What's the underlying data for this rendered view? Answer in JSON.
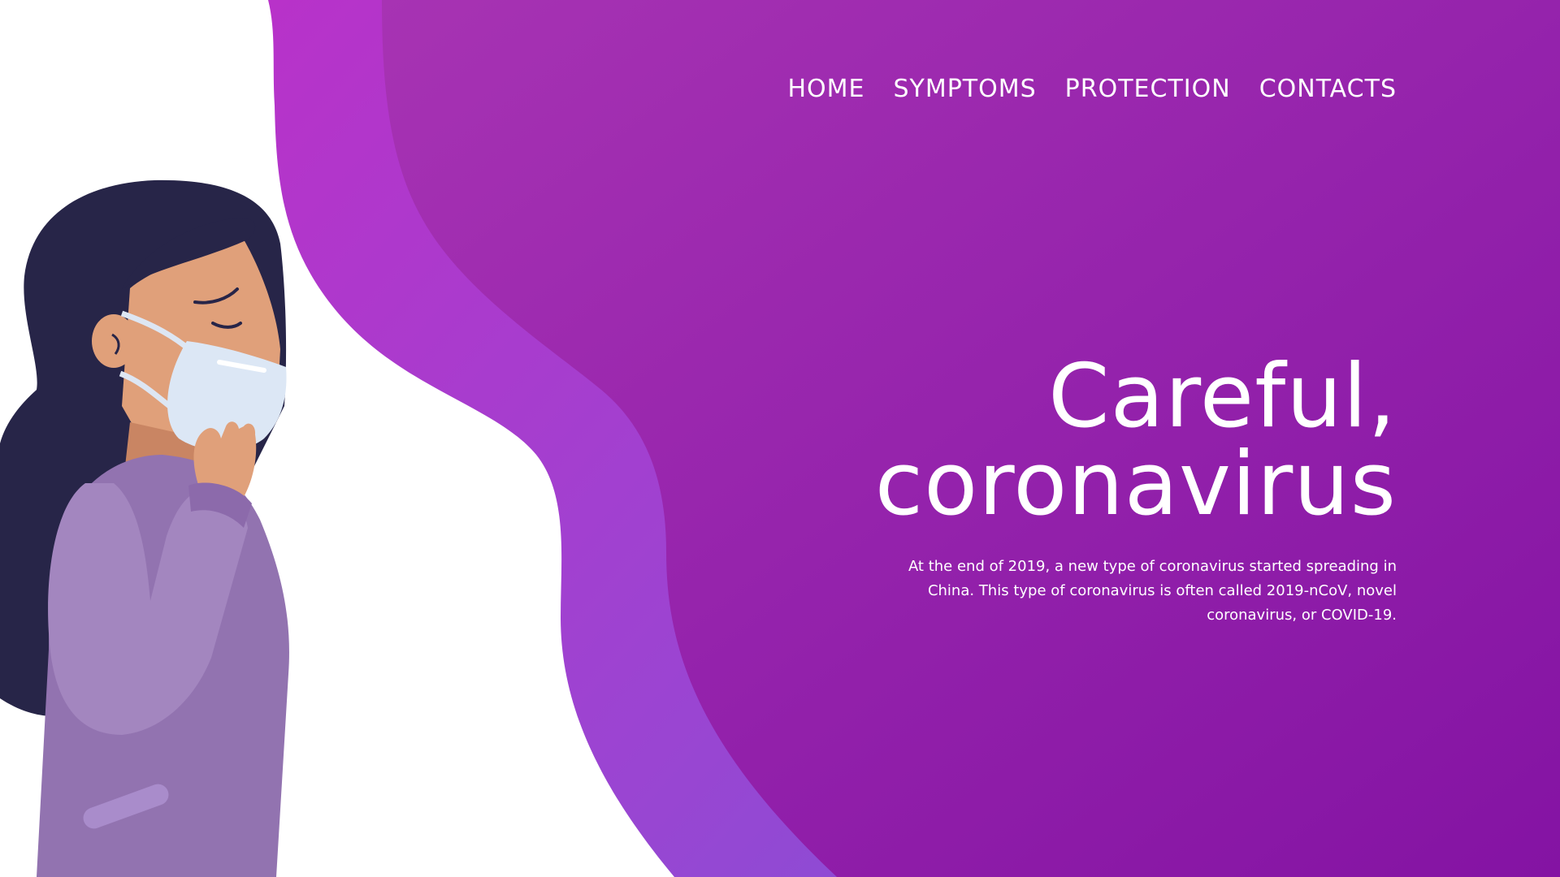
{
  "colors": {
    "background": "#ffffff",
    "brand_purple": "#8c1ea8",
    "wave_light": "#b13cc8",
    "wave_blue": "#8b4fd0",
    "text": "#ffffff"
  },
  "nav": {
    "items": [
      {
        "label": "HOME"
      },
      {
        "label": "SYMPTOMS"
      },
      {
        "label": "PROTECTION"
      },
      {
        "label": "CONTACTS"
      }
    ]
  },
  "hero": {
    "title_line1": "Careful,",
    "title_line2": "coronavirus",
    "description": "At the end of 2019, a new type of coronavirus started spreading in China. This type of coronavirus is often called 2019-nCoV, novel coronavirus, or COVID-19."
  },
  "illustration": {
    "subject": "woman-with-face-mask-icon"
  }
}
